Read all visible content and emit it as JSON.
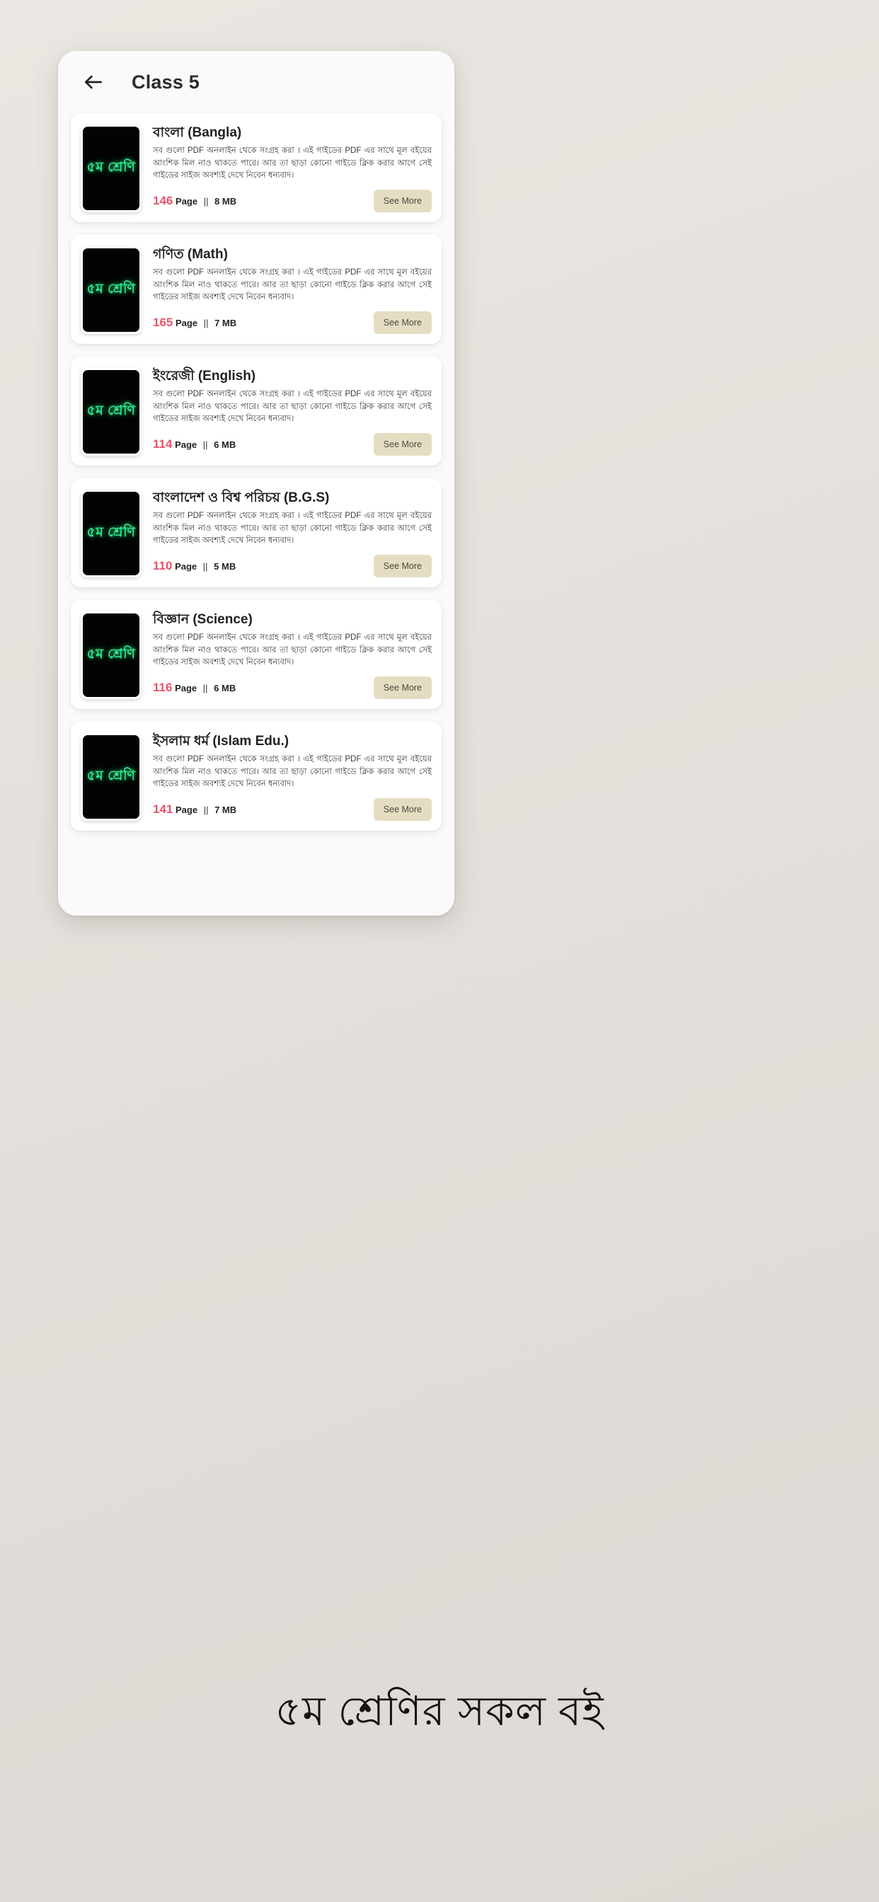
{
  "app": {
    "back_icon": "arrow-left-icon",
    "title": "Class 5"
  },
  "common": {
    "description": "সব গুলো PDF অনলাইন থেকে সংগ্রহ করা । এই গাইডের PDF এর সাথে মূল বইয়ের আংশিক মিল নাও থাকতে পারে। আর তা ছাড়া কোনো গাইডে ক্লিক করার আগে সেই গাইডের সাইজ অবশ্যই দেখে নিবেন ধন্যবাদ।",
    "thumb_label": "৫ম শ্রেণি",
    "see_more_label": "See More",
    "page_unit": "Page",
    "separator": "||"
  },
  "books": [
    {
      "title": "বাংলা (Bangla)",
      "pages": "146",
      "size": "8 MB"
    },
    {
      "title": "গণিত (Math)",
      "pages": "165",
      "size": "7 MB"
    },
    {
      "title": "ইংরেজী (English)",
      "pages": "114",
      "size": "6 MB"
    },
    {
      "title": "বাংলাদেশ ও বিশ্ব পরিচয় (B.G.S)",
      "pages": "110",
      "size": "5 MB"
    },
    {
      "title": "বিজ্ঞান (Science)",
      "pages": "116",
      "size": "6 MB"
    },
    {
      "title": "ইসলাম ধর্ম (Islam Edu.)",
      "pages": "141",
      "size": "7 MB"
    }
  ],
  "caption": "৫ম শ্রেণির সকল বই",
  "colors": {
    "page_number": "#e8536a",
    "thumb_text": "#2ee38a",
    "see_more_bg": "#e4ddc2",
    "background": "#e6e2dd"
  }
}
